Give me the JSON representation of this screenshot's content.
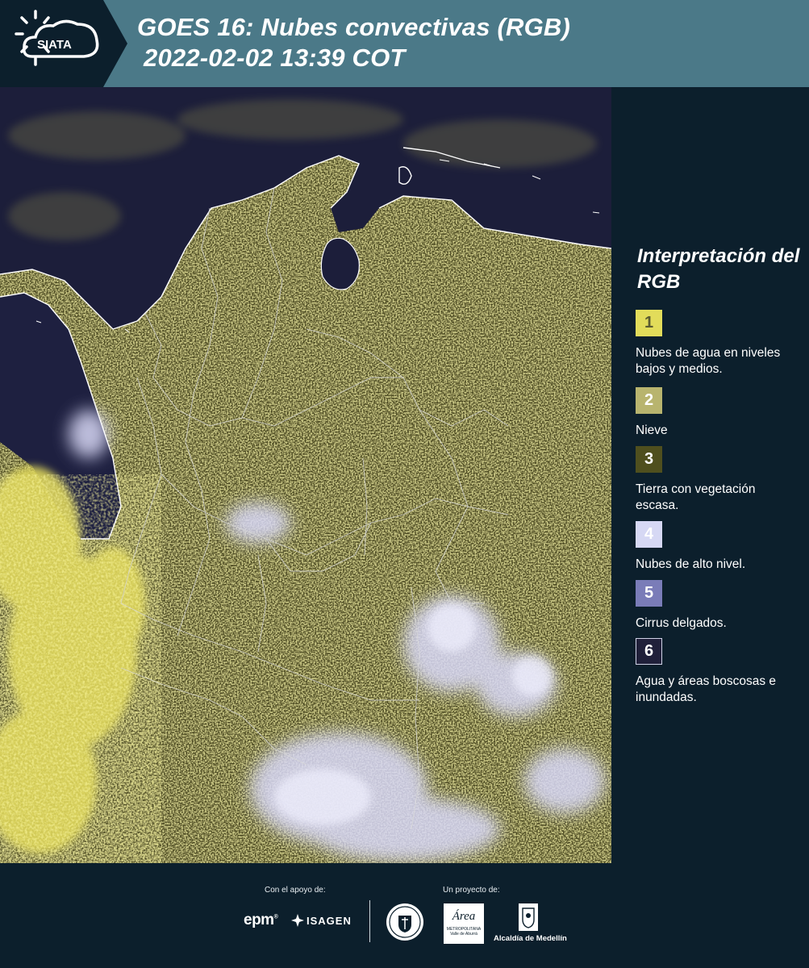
{
  "header": {
    "logo_text": "SIATA",
    "title_line1": "GOES 16: Nubes convectivas (RGB)",
    "title_line2": "2022-02-02 13:39 COT"
  },
  "legend": {
    "title": "Interpretación del RGB",
    "items": [
      {
        "number": "1",
        "label": "Nubes de agua en niveles bajos y medios.",
        "color": "#e2dc5a",
        "text_color": "#5a5a30"
      },
      {
        "number": "2",
        "label": "Nieve",
        "color": "#b8b46e",
        "text_color": "#ffffff"
      },
      {
        "number": "3",
        "label": "Tierra con vegetación escasa.",
        "color": "#4f4f1e",
        "text_color": "#ffffff"
      },
      {
        "number": "4",
        "label": "Nubes de alto nivel.",
        "color": "#d6d8f4",
        "text_color": "#ffffff"
      },
      {
        "number": "5",
        "label": "Cirrus delgados.",
        "color": "#7a7cb8",
        "text_color": "#ffffff"
      },
      {
        "number": "6",
        "label": "Agua y áreas boscosas e inundadas.",
        "color": "#20203a",
        "text_color": "#ffffff"
      }
    ]
  },
  "footer": {
    "support_label": "Con el apoyo de:",
    "project_label": "Un proyecto de:",
    "epm": "epm",
    "isagen": "ISAGEN",
    "area_name": "Área",
    "area_sub1": "METROPOLITANA",
    "area_sub2": "Valle de Aburrá",
    "alcaldia": "Alcaldía de Medellín"
  },
  "colors": {
    "header_bg": "#4b7988",
    "logo_bg": "#0c1f2c",
    "panel_bg": "#0c1f2c",
    "ocean": "#1c1e3a",
    "low_cloud": "#e6e060",
    "vegetation": "#565322",
    "high_cloud": "#dcdcf6"
  }
}
